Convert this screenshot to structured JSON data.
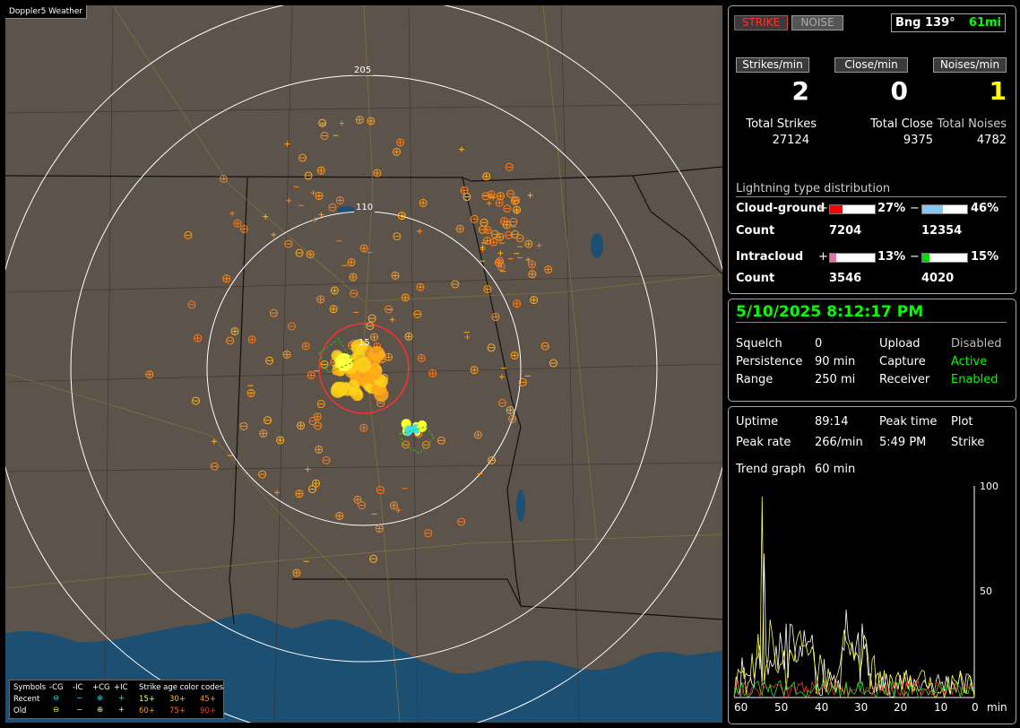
{
  "map": {
    "title": "Doppler5 Weather",
    "rings": [
      "205",
      "110",
      "15"
    ],
    "legend": {
      "symbols_label": "Symbols",
      "headers": [
        "-CG",
        "-IC",
        "+CG",
        "+IC"
      ],
      "recent_label": "Recent",
      "old_label": "Old",
      "age_title": "Strike age color codes",
      "ages_recent": [
        "15+",
        "30+",
        "45+"
      ],
      "ages_old": [
        "60+",
        "75+",
        "90+"
      ],
      "recent_symbols": [
        "⊖",
        "−",
        "⊕",
        "+"
      ],
      "old_symbols": [
        "⊖",
        "−",
        "⊕",
        "+"
      ]
    }
  },
  "panel1": {
    "strike_button": "STRIKE",
    "noise_button": "NOISE",
    "bearing": "Bng 139°",
    "distance": "61mi",
    "rate_labels": [
      "Strikes/min",
      "Close/min",
      "Noises/min"
    ],
    "rate_values": [
      "2",
      "0",
      "1"
    ],
    "total_labels": [
      "Total Strikes",
      "Total Close",
      "Total Noises"
    ],
    "total_values": [
      "27124",
      "9375",
      "4782"
    ],
    "dist_title": "Lightning type distribution",
    "cg_label": "Cloud-ground",
    "cg_pos_sign": "+",
    "cg_pos_pct": "27%",
    "cg_neg_sign": "−",
    "cg_neg_pct": "46%",
    "count_label": "Count",
    "cg_pos_count": "7204",
    "cg_neg_count": "12354",
    "ic_label": "Intracloud",
    "ic_pos_sign": "+",
    "ic_pos_pct": "13%",
    "ic_neg_sign": "−",
    "ic_neg_pct": "15%",
    "ic_pos_count": "3546",
    "ic_neg_count": "4020",
    "cg_pos_fill": 0.27,
    "cg_neg_fill": 0.46,
    "ic_pos_fill": 0.13,
    "ic_neg_fill": 0.15
  },
  "panel2": {
    "datetime": "5/10/2025 8:12:17 PM",
    "squelch_label": "Squelch",
    "squelch_value": "0",
    "persistence_label": "Persistence",
    "persistence_value": "90 min",
    "range_label": "Range",
    "range_value": "250 mi",
    "upload_label": "Upload",
    "upload_value": "Disabled",
    "capture_label": "Capture",
    "capture_value": "Active",
    "receiver_label": "Receiver",
    "receiver_value": "Enabled"
  },
  "panel3": {
    "uptime_label": "Uptime",
    "uptime_value": "89:14",
    "peak_time_label": "Peak time",
    "peak_time_value": "5:49 PM",
    "plot_label": "Plot",
    "plot_value": "Strike",
    "peak_rate_label": "Peak rate",
    "peak_rate_value": "266/min",
    "trend_label": "Trend graph",
    "trend_value": "60 min",
    "y_ticks": [
      "100",
      "50"
    ],
    "x_ticks": [
      "60",
      "50",
      "40",
      "30",
      "20",
      "10",
      "0"
    ],
    "x_unit": "min"
  },
  "colors": {
    "map_bg": "#5c534b",
    "water": "#1d4f73",
    "strike_red": "#ff3030",
    "green": "#00ff00",
    "yellow": "#ffff00",
    "orange": "#ff9a1a",
    "cg_pos_bar": "#ff0000",
    "cg_neg_bar": "#86c8f0",
    "ic_pos_bar": "#e86ea8",
    "ic_neg_bar": "#00dd00"
  }
}
